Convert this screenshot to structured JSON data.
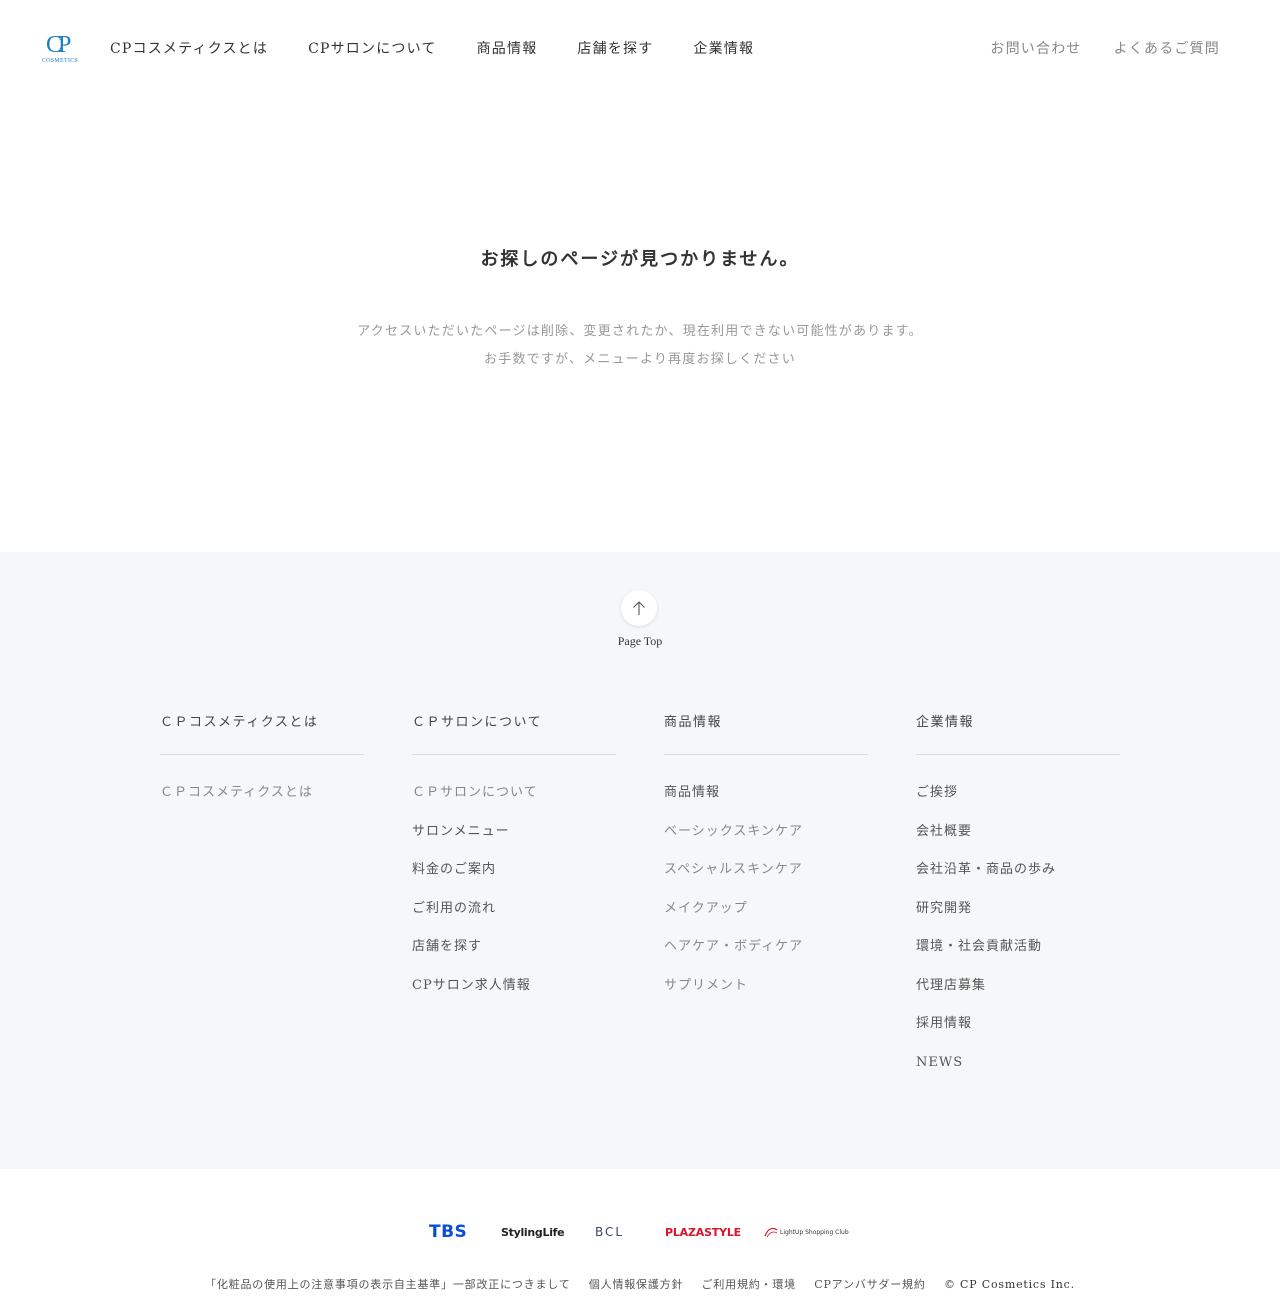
{
  "header": {
    "logo_mark": "CP",
    "logo_sub": "COSMETICS",
    "nav_main": [
      "CPコスメティクスとは",
      "CPサロンについて",
      "商品情報",
      "店舗を探す",
      "企業情報"
    ],
    "nav_sub": [
      "お問い合わせ",
      "よくあるご質問"
    ]
  },
  "main": {
    "title": "お探しのページが見つかりません。",
    "message_line1": "アクセスいただいたページは削除、変更されたか、現在利用できない可能性があります。",
    "message_line2": "お手数ですが、メニューより再度お探しください"
  },
  "footer_nav": {
    "page_top": "Page Top",
    "columns": [
      {
        "heading": "ＣＰコスメティクスとは",
        "items": [
          "ＣＰコスメティクスとは"
        ]
      },
      {
        "heading": "ＣＰサロンについて",
        "items": [
          "ＣＰサロンについて",
          "サロンメニュー",
          "料金のご案内",
          "ご利用の流れ",
          "店舗を探す",
          "CPサロン求人情報"
        ]
      },
      {
        "heading": "商品情報",
        "items": [
          "商品情報",
          "ベーシックスキンケア",
          "スペシャルスキンケア",
          "メイクアップ",
          "ヘアケア・ボディケア",
          "サプリメント"
        ]
      },
      {
        "heading": "企業情報",
        "items": [
          "ご挨拶",
          "会社概要",
          "会社沿革・商品の歩み",
          "研究開発",
          "環境・社会貢献活動",
          "代理店募集",
          "採用情報",
          "NEWS"
        ]
      }
    ]
  },
  "brands": {
    "tbs": "TBS",
    "styling_life": "StylingLife",
    "bcl": "BCL",
    "plazastyle": "PLAZASTYLE",
    "lightup": "LightUp Shopping Club"
  },
  "footer_links": [
    "「化粧品の使用上の注意事項の表示自主基準」一部改正につきまして",
    "個人情報保護方針",
    "ご利用規約・環境",
    "CPアンバサダー規約"
  ],
  "copyright": "© CP Cosmetics Inc.",
  "colors": {
    "brand_blue": "#1b7fc6",
    "tbs_blue": "#0a4fd1",
    "plaza_red": "#d7142a",
    "footer_bg": "#f6f7f8"
  }
}
